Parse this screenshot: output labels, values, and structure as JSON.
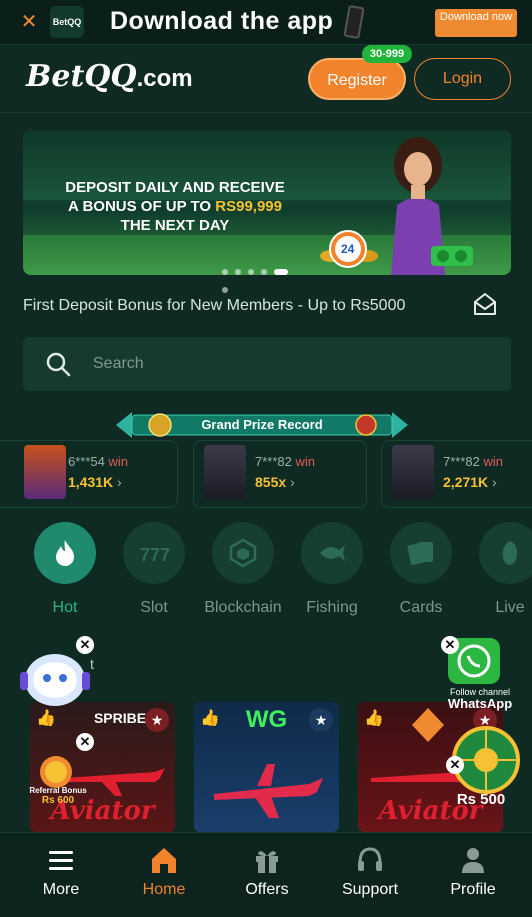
{
  "app_banner": {
    "title": "Download the app",
    "button_label": "Download now"
  },
  "header": {
    "logo_text": "BetQQ",
    "logo_suffix": ".com",
    "register_label": "Register",
    "register_badge": "30-999",
    "login_label": "Login"
  },
  "hero": {
    "promo_line1": "DEPOSIT DAILY AND RECEIVE",
    "promo_line2_prefix": "A BONUS OF UP TO",
    "promo_amount": "RS99,999",
    "promo_line3": "THE NEXT DAY",
    "badge_number": "24",
    "slides_count": 6,
    "active_slide": 5
  },
  "marquee": {
    "text": "First Deposit Bonus for New Members - Up to Rs5000"
  },
  "search": {
    "placeholder": "Search"
  },
  "grand_prize": {
    "title": "Grand Prize Record",
    "records": [
      {
        "user": "6***54",
        "win_label": "win",
        "amount": "1,431K"
      },
      {
        "user": "7***82",
        "win_label": "win",
        "amount": "855x"
      },
      {
        "user": "7***82",
        "win_label": "win",
        "amount": "2,271K"
      }
    ]
  },
  "categories": [
    {
      "label": "Hot",
      "icon": "flame-icon",
      "active": true
    },
    {
      "label": "Slot",
      "icon": "slot-777-icon",
      "active": false
    },
    {
      "label": "Blockchain",
      "icon": "blockchain-cube-icon",
      "active": false
    },
    {
      "label": "Fishing",
      "icon": "fish-icon",
      "active": false
    },
    {
      "label": "Cards",
      "icon": "cards-icon",
      "active": false
    },
    {
      "label": "Live",
      "icon": "live-dealer-icon",
      "active": false
    }
  ],
  "floating": {
    "whatsapp_caption": "Follow channel",
    "whatsapp_label": "WhatsApp",
    "referral_caption": "Referral Bonus",
    "referral_amount": "Rs 600",
    "wheel_amount": "Rs 500",
    "hidden_text": "t"
  },
  "games": [
    {
      "provider": "SPRIBE",
      "title": "Aviator"
    },
    {
      "provider": "WG",
      "title": ""
    },
    {
      "provider": "",
      "title": "Aviator"
    }
  ],
  "bottom_nav": {
    "items": [
      {
        "label": "More",
        "icon": "menu-icon"
      },
      {
        "label": "Home",
        "icon": "home-icon",
        "active": true
      },
      {
        "label": "Offers",
        "icon": "gift-icon"
      },
      {
        "label": "Support",
        "icon": "headset-icon"
      },
      {
        "label": "Profile",
        "icon": "profile-icon"
      }
    ]
  },
  "colors": {
    "background": "#0e2a22",
    "accent": "#f0832c",
    "active_category": "#1f8a6e",
    "gold": "#f6c233"
  }
}
